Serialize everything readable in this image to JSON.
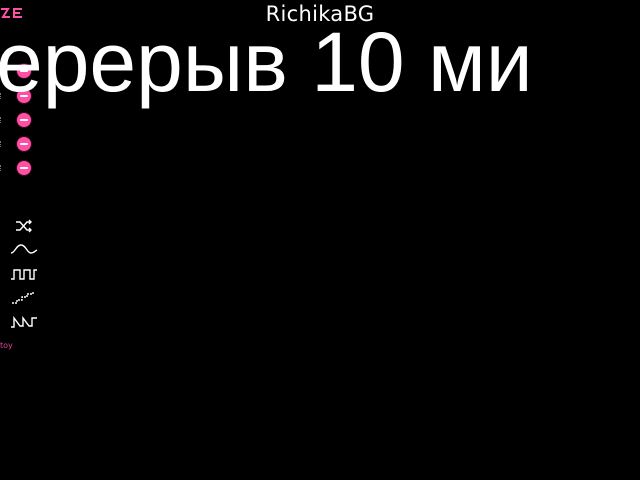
{
  "header": {
    "title": "RichikaBG"
  },
  "overlay": {
    "text": "ерерыв 10 ми"
  },
  "sidebar": {
    "toy_label": "toy",
    "pattern_icons": [
      "shuffle-icon",
      "wave-icon",
      "pulse-icon",
      "staircase-icon",
      "sawtooth-icon"
    ]
  },
  "colors": {
    "accent": "#ff4fa3",
    "background": "#000000",
    "text": "#ffffff"
  }
}
